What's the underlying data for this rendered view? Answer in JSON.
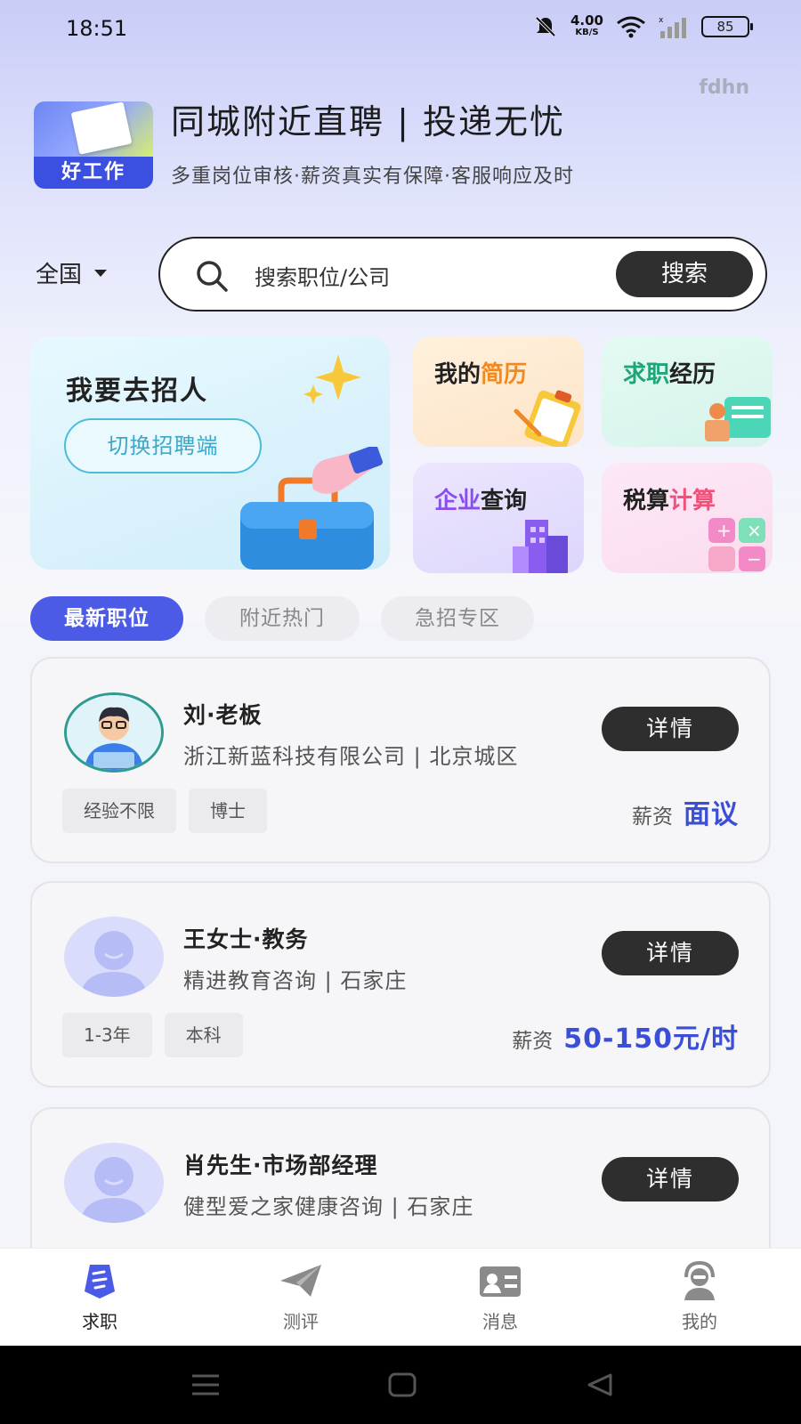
{
  "status_bar": {
    "time": "18:51",
    "net_speed": "4.00",
    "net_unit": "KB/S",
    "battery": "85"
  },
  "watermark": "fdhn",
  "header": {
    "logo_label": "好工作",
    "title": "同城附近直聘 | 投递无忧",
    "subtitle": "多重岗位审核·薪资真实有保障·客服响应及时"
  },
  "search": {
    "region": "全国",
    "placeholder": "搜索职位/公司",
    "button": "搜索"
  },
  "features": {
    "recruit": {
      "title": "我要去招人",
      "button": "切换招聘端"
    },
    "resume": {
      "part1": "我的",
      "part2": "简历"
    },
    "experience": {
      "part1": "求职",
      "part2": "经历"
    },
    "company": {
      "part1": "企业",
      "part2": "查询"
    },
    "tax": {
      "part1": "税算",
      "part2": "计算"
    }
  },
  "tabs": [
    "最新职位",
    "附近热门",
    "急招专区"
  ],
  "jobs": [
    {
      "name": "刘·老板",
      "company": "浙江新蓝科技有限公司 | 北京城区",
      "detail": "详情",
      "tags": [
        "经验不限",
        "博士"
      ],
      "salary_label": "薪资",
      "salary": "面议"
    },
    {
      "name": "王女士·教务",
      "company": "精进教育咨询 | 石家庄",
      "detail": "详情",
      "tags": [
        "1-3年",
        "本科"
      ],
      "salary_label": "薪资",
      "salary": "50-150元/时"
    },
    {
      "name": "肖先生·市场部经理",
      "company": "健型爱之家健康咨询 | 石家庄",
      "detail": "详情",
      "tags": [],
      "salary_label": "",
      "salary": ""
    }
  ],
  "bottom_nav": [
    {
      "label": "求职",
      "icon": "tie-icon",
      "active": true
    },
    {
      "label": "测评",
      "icon": "paper-plane-icon",
      "active": false
    },
    {
      "label": "消息",
      "icon": "id-card-icon",
      "active": false
    },
    {
      "label": "我的",
      "icon": "headset-user-icon",
      "active": false
    }
  ],
  "colors": {
    "accent": "#4b5be6",
    "salary": "#3b4ed8",
    "button_dark": "#2e2e2e"
  }
}
